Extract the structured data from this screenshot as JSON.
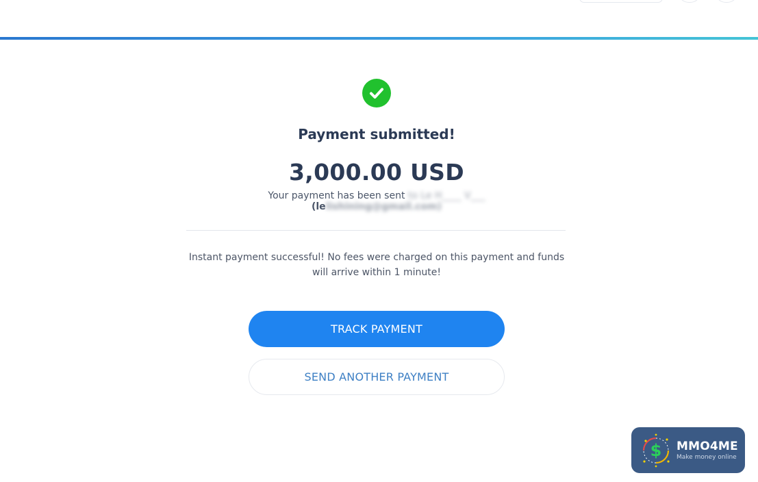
{
  "colors": {
    "success": "#21c12e",
    "primary_button": "#1f84f0",
    "heading": "#2b3a55",
    "secondary_text": "#3d7fc4"
  },
  "status": {
    "icon": "check-circle-icon",
    "title": "Payment submitted!",
    "amount": "3,000.00 USD",
    "sent_prefix": "Your payment has been sent",
    "sent_suffix": "to Le H____ V___",
    "recipient_open": "(le",
    "recipient_rest": "lishining@gmail.com)"
  },
  "info": {
    "message": "Instant payment successful! No fees were charged on this payment and funds will arrive within 1 minute!"
  },
  "actions": {
    "track_label": "TRACK PAYMENT",
    "send_another_label": "SEND ANOTHER PAYMENT"
  },
  "watermark": {
    "name": "MMO4ME",
    "tagline": "Make money online",
    "icon": "dollar-sign-icon"
  }
}
